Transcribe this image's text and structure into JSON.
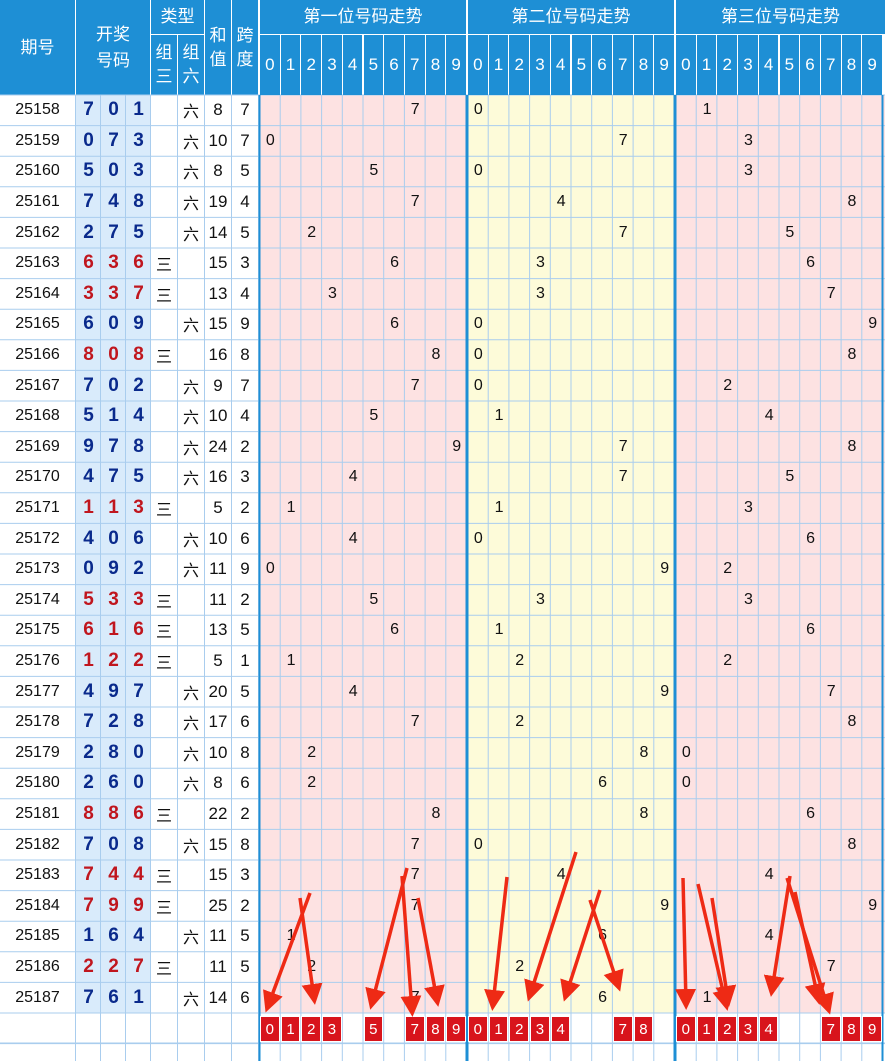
{
  "header": {
    "issue_label": "期号",
    "draw_label_1": "开奖",
    "draw_label_2": "号码",
    "type_label": "类型",
    "type_z3_1": "组",
    "type_z3_2": "三",
    "type_z6_1": "组",
    "type_z6_2": "六",
    "sum_label_1": "和",
    "sum_label_2": "值",
    "span_label_1": "跨",
    "span_label_2": "度",
    "pos1_label": "第一位号码走势",
    "pos2_label": "第二位号码走势",
    "pos3_label": "第三位号码走势",
    "digits": [
      "0",
      "1",
      "2",
      "3",
      "4",
      "5",
      "6",
      "7",
      "8",
      "9"
    ]
  },
  "colors": {
    "header_bg": "#1e8fd5",
    "red_text": "#c0161e",
    "blue_text": "#0a2a8c",
    "pos1_bg": "#fde2e2",
    "pos2_bg": "#fdfbd9",
    "pos3_bg": "#fde2e2",
    "draw_bg": "#d9ebfb",
    "grid_line": "#a9cdee",
    "footer_mark": "#d8141c",
    "arrow": "#ee2a15"
  },
  "chart_data": {
    "type": "table",
    "rows": [
      {
        "issue": "25158",
        "d": [
          7,
          0,
          1
        ],
        "z3": "",
        "z6": "六",
        "sum": 8,
        "span": 7
      },
      {
        "issue": "25159",
        "d": [
          0,
          7,
          3
        ],
        "z3": "",
        "z6": "六",
        "sum": 10,
        "span": 7
      },
      {
        "issue": "25160",
        "d": [
          5,
          0,
          3
        ],
        "z3": "",
        "z6": "六",
        "sum": 8,
        "span": 5
      },
      {
        "issue": "25161",
        "d": [
          7,
          4,
          8
        ],
        "z3": "",
        "z6": "六",
        "sum": 19,
        "span": 4
      },
      {
        "issue": "25162",
        "d": [
          2,
          7,
          5
        ],
        "z3": "",
        "z6": "六",
        "sum": 14,
        "span": 5
      },
      {
        "issue": "25163",
        "d": [
          6,
          3,
          6
        ],
        "z3": "三",
        "z6": "",
        "sum": 15,
        "span": 3
      },
      {
        "issue": "25164",
        "d": [
          3,
          3,
          7
        ],
        "z3": "三",
        "z6": "",
        "sum": 13,
        "span": 4
      },
      {
        "issue": "25165",
        "d": [
          6,
          0,
          9
        ],
        "z3": "",
        "z6": "六",
        "sum": 15,
        "span": 9
      },
      {
        "issue": "25166",
        "d": [
          8,
          0,
          8
        ],
        "z3": "三",
        "z6": "",
        "sum": 16,
        "span": 8
      },
      {
        "issue": "25167",
        "d": [
          7,
          0,
          2
        ],
        "z3": "",
        "z6": "六",
        "sum": 9,
        "span": 7
      },
      {
        "issue": "25168",
        "d": [
          5,
          1,
          4
        ],
        "z3": "",
        "z6": "六",
        "sum": 10,
        "span": 4
      },
      {
        "issue": "25169",
        "d": [
          9,
          7,
          8
        ],
        "z3": "",
        "z6": "六",
        "sum": 24,
        "span": 2
      },
      {
        "issue": "25170",
        "d": [
          4,
          7,
          5
        ],
        "z3": "",
        "z6": "六",
        "sum": 16,
        "span": 3
      },
      {
        "issue": "25171",
        "d": [
          1,
          1,
          3
        ],
        "z3": "三",
        "z6": "",
        "sum": 5,
        "span": 2
      },
      {
        "issue": "25172",
        "d": [
          4,
          0,
          6
        ],
        "z3": "",
        "z6": "六",
        "sum": 10,
        "span": 6
      },
      {
        "issue": "25173",
        "d": [
          0,
          9,
          2
        ],
        "z3": "",
        "z6": "六",
        "sum": 11,
        "span": 9
      },
      {
        "issue": "25174",
        "d": [
          5,
          3,
          3
        ],
        "z3": "三",
        "z6": "",
        "sum": 11,
        "span": 2
      },
      {
        "issue": "25175",
        "d": [
          6,
          1,
          6
        ],
        "z3": "三",
        "z6": "",
        "sum": 13,
        "span": 5
      },
      {
        "issue": "25176",
        "d": [
          1,
          2,
          2
        ],
        "z3": "三",
        "z6": "",
        "sum": 5,
        "span": 1
      },
      {
        "issue": "25177",
        "d": [
          4,
          9,
          7
        ],
        "z3": "",
        "z6": "六",
        "sum": 20,
        "span": 5
      },
      {
        "issue": "25178",
        "d": [
          7,
          2,
          8
        ],
        "z3": "",
        "z6": "六",
        "sum": 17,
        "span": 6
      },
      {
        "issue": "25179",
        "d": [
          2,
          8,
          0
        ],
        "z3": "",
        "z6": "六",
        "sum": 10,
        "span": 8
      },
      {
        "issue": "25180",
        "d": [
          2,
          6,
          0
        ],
        "z3": "",
        "z6": "六",
        "sum": 8,
        "span": 6
      },
      {
        "issue": "25181",
        "d": [
          8,
          8,
          6
        ],
        "z3": "三",
        "z6": "",
        "sum": 22,
        "span": 2
      },
      {
        "issue": "25182",
        "d": [
          7,
          0,
          8
        ],
        "z3": "",
        "z6": "六",
        "sum": 15,
        "span": 8
      },
      {
        "issue": "25183",
        "d": [
          7,
          4,
          4
        ],
        "z3": "三",
        "z6": "",
        "sum": 15,
        "span": 3
      },
      {
        "issue": "25184",
        "d": [
          7,
          9,
          9
        ],
        "z3": "三",
        "z6": "",
        "sum": 25,
        "span": 2
      },
      {
        "issue": "25185",
        "d": [
          1,
          6,
          4
        ],
        "z3": "",
        "z6": "六",
        "sum": 11,
        "span": 5
      },
      {
        "issue": "25186",
        "d": [
          2,
          2,
          7
        ],
        "z3": "三",
        "z6": "",
        "sum": 11,
        "span": 5
      },
      {
        "issue": "25187",
        "d": [
          7,
          6,
          1
        ],
        "z3": "",
        "z6": "六",
        "sum": 14,
        "span": 6
      }
    ],
    "footer_picks": [
      [
        0,
        1,
        2,
        3,
        5,
        7,
        8,
        9
      ],
      [
        0,
        1,
        2,
        3,
        4,
        7,
        8
      ],
      [
        0,
        1,
        2,
        3,
        4,
        7,
        8,
        9
      ]
    ]
  }
}
